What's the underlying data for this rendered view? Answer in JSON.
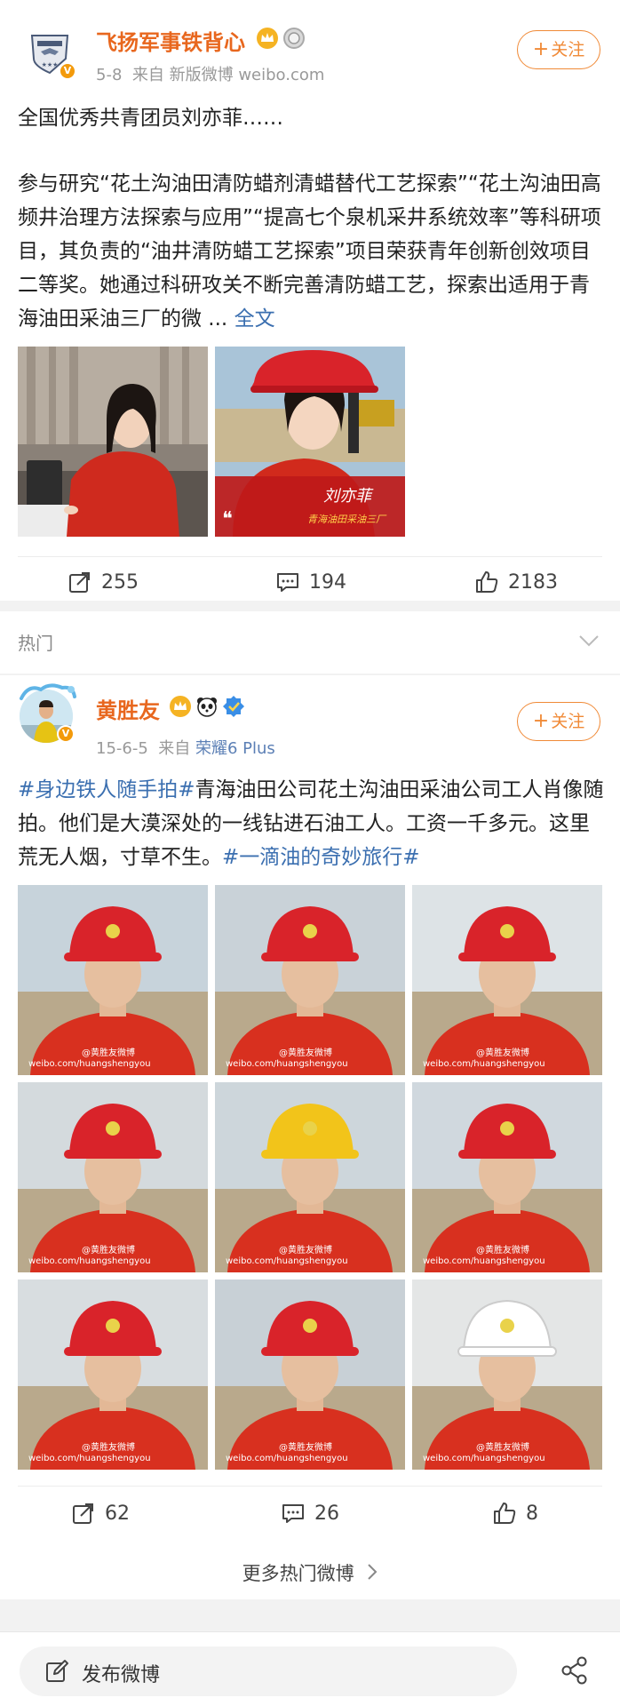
{
  "post1": {
    "username": "飞扬军事铁背心",
    "date": "5-8",
    "source_prefix": "来自",
    "source": "新版微博 weibo.com",
    "follow_label": "关注",
    "line1": "全国优秀共青团员刘亦菲……",
    "para": "参与研究“花土沟油田清防蜡剂清蜡替代工艺探索”“花土沟油田高频井治理方法探索与应用”“提高七个泉机采井系统效率”等科研项目，其负责的“油井清防蜡工艺探索”项目荣获青年创新创效项目二等奖。她通过科研攻关不断完善清防蜡工艺，探索出适用于青海油田采油三厂的微",
    "ellipsis": " ... ",
    "full_text": "全文",
    "photo2_caption_name": "刘亦菲",
    "photo2_caption_sub": "青海油田采油三厂",
    "repost": "255",
    "comment": "194",
    "like": "2183"
  },
  "hot": {
    "label": "热门"
  },
  "post2": {
    "username": "黄胜友",
    "date": "15-6-5",
    "source_prefix": "来自",
    "source": "荣耀6 Plus",
    "follow_label": "关注",
    "tag1": "#身边铁人随手拍#",
    "text": "青海油田公司花土沟油田采油公司工人肖像随拍。他们是大漠深处的一线钻进石油工人。工资一千多元。这里荒无人烟，寸草不生。",
    "tag2": "#一滴油的奇妙旅行#",
    "watermark1": "@黄胜友微博",
    "watermark2": "weibo.com/huangshengyou",
    "repost": "62",
    "comment": "26",
    "like": "8"
  },
  "more_hot": "更多热门微博",
  "bottom": {
    "publish": "发布微博"
  },
  "colors": {
    "accent": "#f08a37",
    "link": "#3b6fb0",
    "username": "#e8671e",
    "helmet_red": "#d9232a",
    "uniform_red": "#d8301f"
  },
  "icons": [
    "shield-avatar-icon",
    "crown-icon",
    "medal-icon",
    "panda-icon",
    "blue-badge-icon",
    "repost-icon",
    "comment-icon",
    "like-icon",
    "chevron-down-icon",
    "chevron-right-icon",
    "edit-icon",
    "share-icon"
  ]
}
